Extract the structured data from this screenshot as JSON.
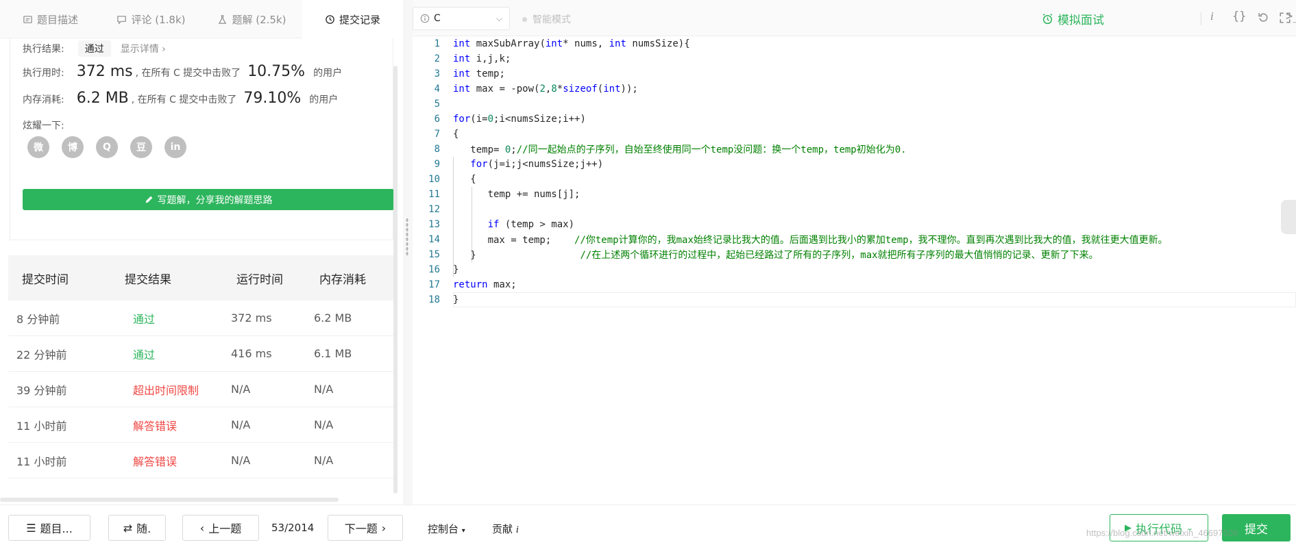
{
  "tabs": [
    {
      "label": "题目描述",
      "icon": "doc-icon"
    },
    {
      "label": "评论 (1.8k)",
      "icon": "comment-icon"
    },
    {
      "label": "题解 (2.5k)",
      "icon": "flask-icon"
    },
    {
      "label": "提交记录",
      "icon": "clock-icon"
    }
  ],
  "result": {
    "status_label": "执行结果:",
    "status": "通过",
    "detail": "显示详情 ›",
    "time_label": "执行用时:",
    "time_value": "372 ms",
    "time_text": ", 在所有 C 提交中击败了",
    "time_pct": "10.75%",
    "users": "的用户",
    "mem_label": "内存消耗:",
    "mem_value": "6.2 MB",
    "mem_text": ", 在所有 C 提交中击败了",
    "mem_pct": "79.10%",
    "share_label": "炫耀一下:",
    "share_icons": [
      "wechat-icon",
      "weibo-icon",
      "qq-icon",
      "douban-icon",
      "linkedin-icon"
    ],
    "share_glyphs": [
      "微",
      "博",
      "Q",
      "豆",
      "in"
    ],
    "write_button": "写题解，分享我的解题思路"
  },
  "submissions": {
    "headers": [
      "提交时间",
      "提交结果",
      "运行时间",
      "内存消耗"
    ],
    "rows": [
      {
        "time": "8 分钟前",
        "result": "通过",
        "status": "ok",
        "runtime": "372 ms",
        "memory": "6.2 MB"
      },
      {
        "time": "22 分钟前",
        "result": "通过",
        "status": "ok",
        "runtime": "416 ms",
        "memory": "6.1 MB"
      },
      {
        "time": "39 分钟前",
        "result": "超出时间限制",
        "status": "bad",
        "runtime": "N/A",
        "memory": "N/A"
      },
      {
        "time": "11 小时前",
        "result": "解答错误",
        "status": "bad",
        "runtime": "N/A",
        "memory": "N/A"
      },
      {
        "time": "11 小时前",
        "result": "解答错误",
        "status": "bad",
        "runtime": "N/A",
        "memory": "N/A"
      }
    ]
  },
  "toolbar": {
    "language": "C",
    "smart_mode": "智能模式",
    "mock_interview": "模拟面试",
    "icons": [
      "info-icon",
      "braces-icon",
      "reset-icon",
      "terminal-icon",
      "settings-icon"
    ]
  },
  "code_lines": [
    "int maxSubArray(int* nums, int numsSize){",
    "int i,j,k;",
    "int temp;",
    "int max = -pow(2,8*sizeof(int));",
    "",
    "for(i=0;i<numsSize;i++)",
    "{",
    "    temp= 0;//同一起始点的子序列，自始至终使用同一个temp没问题：换一个temp，temp初始化为0.",
    "    for(j=i;j<numsSize;j++)",
    "    {",
    "        temp += nums[j];",
    "",
    "        if (temp > max)",
    "        max = temp;    //你temp计算你的，我max始终记录比我大的值。后面遇到比我小的累加temp，我不理你。直到再次遇到比我大的值，我就往更大值更新。",
    "    }                  //在上述两个循环进行的过程中，起始已经路过了所有的子序列，max就把所有子序列的最大值悄悄的记录、更新了下来。",
    "}",
    "return max;",
    "}"
  ],
  "footer": {
    "problems": "题目...",
    "random": "随.",
    "prev": "上一题",
    "progress": "53/2014",
    "next": "下一题",
    "console": "控制台",
    "contribute": "贡献",
    "run": "执行代码",
    "submit": "提交"
  },
  "watermark": "https://blog.csdn.net/weixin_46697509"
}
